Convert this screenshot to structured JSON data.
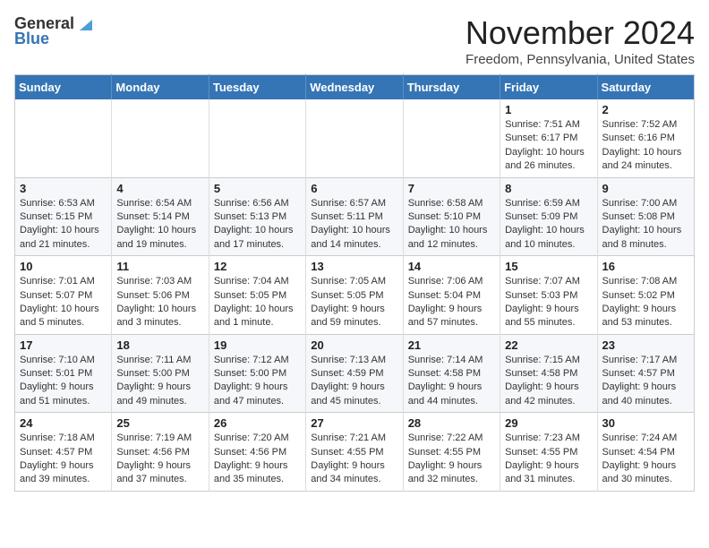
{
  "logo": {
    "line1": "General",
    "line2": "Blue"
  },
  "title": "November 2024",
  "location": "Freedom, Pennsylvania, United States",
  "weekdays": [
    "Sunday",
    "Monday",
    "Tuesday",
    "Wednesday",
    "Thursday",
    "Friday",
    "Saturday"
  ],
  "weeks": [
    [
      {
        "day": "",
        "info": ""
      },
      {
        "day": "",
        "info": ""
      },
      {
        "day": "",
        "info": ""
      },
      {
        "day": "",
        "info": ""
      },
      {
        "day": "",
        "info": ""
      },
      {
        "day": "1",
        "info": "Sunrise: 7:51 AM\nSunset: 6:17 PM\nDaylight: 10 hours\nand 26 minutes."
      },
      {
        "day": "2",
        "info": "Sunrise: 7:52 AM\nSunset: 6:16 PM\nDaylight: 10 hours\nand 24 minutes."
      }
    ],
    [
      {
        "day": "3",
        "info": "Sunrise: 6:53 AM\nSunset: 5:15 PM\nDaylight: 10 hours\nand 21 minutes."
      },
      {
        "day": "4",
        "info": "Sunrise: 6:54 AM\nSunset: 5:14 PM\nDaylight: 10 hours\nand 19 minutes."
      },
      {
        "day": "5",
        "info": "Sunrise: 6:56 AM\nSunset: 5:13 PM\nDaylight: 10 hours\nand 17 minutes."
      },
      {
        "day": "6",
        "info": "Sunrise: 6:57 AM\nSunset: 5:11 PM\nDaylight: 10 hours\nand 14 minutes."
      },
      {
        "day": "7",
        "info": "Sunrise: 6:58 AM\nSunset: 5:10 PM\nDaylight: 10 hours\nand 12 minutes."
      },
      {
        "day": "8",
        "info": "Sunrise: 6:59 AM\nSunset: 5:09 PM\nDaylight: 10 hours\nand 10 minutes."
      },
      {
        "day": "9",
        "info": "Sunrise: 7:00 AM\nSunset: 5:08 PM\nDaylight: 10 hours\nand 8 minutes."
      }
    ],
    [
      {
        "day": "10",
        "info": "Sunrise: 7:01 AM\nSunset: 5:07 PM\nDaylight: 10 hours\nand 5 minutes."
      },
      {
        "day": "11",
        "info": "Sunrise: 7:03 AM\nSunset: 5:06 PM\nDaylight: 10 hours\nand 3 minutes."
      },
      {
        "day": "12",
        "info": "Sunrise: 7:04 AM\nSunset: 5:05 PM\nDaylight: 10 hours\nand 1 minute."
      },
      {
        "day": "13",
        "info": "Sunrise: 7:05 AM\nSunset: 5:05 PM\nDaylight: 9 hours\nand 59 minutes."
      },
      {
        "day": "14",
        "info": "Sunrise: 7:06 AM\nSunset: 5:04 PM\nDaylight: 9 hours\nand 57 minutes."
      },
      {
        "day": "15",
        "info": "Sunrise: 7:07 AM\nSunset: 5:03 PM\nDaylight: 9 hours\nand 55 minutes."
      },
      {
        "day": "16",
        "info": "Sunrise: 7:08 AM\nSunset: 5:02 PM\nDaylight: 9 hours\nand 53 minutes."
      }
    ],
    [
      {
        "day": "17",
        "info": "Sunrise: 7:10 AM\nSunset: 5:01 PM\nDaylight: 9 hours\nand 51 minutes."
      },
      {
        "day": "18",
        "info": "Sunrise: 7:11 AM\nSunset: 5:00 PM\nDaylight: 9 hours\nand 49 minutes."
      },
      {
        "day": "19",
        "info": "Sunrise: 7:12 AM\nSunset: 5:00 PM\nDaylight: 9 hours\nand 47 minutes."
      },
      {
        "day": "20",
        "info": "Sunrise: 7:13 AM\nSunset: 4:59 PM\nDaylight: 9 hours\nand 45 minutes."
      },
      {
        "day": "21",
        "info": "Sunrise: 7:14 AM\nSunset: 4:58 PM\nDaylight: 9 hours\nand 44 minutes."
      },
      {
        "day": "22",
        "info": "Sunrise: 7:15 AM\nSunset: 4:58 PM\nDaylight: 9 hours\nand 42 minutes."
      },
      {
        "day": "23",
        "info": "Sunrise: 7:17 AM\nSunset: 4:57 PM\nDaylight: 9 hours\nand 40 minutes."
      }
    ],
    [
      {
        "day": "24",
        "info": "Sunrise: 7:18 AM\nSunset: 4:57 PM\nDaylight: 9 hours\nand 39 minutes."
      },
      {
        "day": "25",
        "info": "Sunrise: 7:19 AM\nSunset: 4:56 PM\nDaylight: 9 hours\nand 37 minutes."
      },
      {
        "day": "26",
        "info": "Sunrise: 7:20 AM\nSunset: 4:56 PM\nDaylight: 9 hours\nand 35 minutes."
      },
      {
        "day": "27",
        "info": "Sunrise: 7:21 AM\nSunset: 4:55 PM\nDaylight: 9 hours\nand 34 minutes."
      },
      {
        "day": "28",
        "info": "Sunrise: 7:22 AM\nSunset: 4:55 PM\nDaylight: 9 hours\nand 32 minutes."
      },
      {
        "day": "29",
        "info": "Sunrise: 7:23 AM\nSunset: 4:55 PM\nDaylight: 9 hours\nand 31 minutes."
      },
      {
        "day": "30",
        "info": "Sunrise: 7:24 AM\nSunset: 4:54 PM\nDaylight: 9 hours\nand 30 minutes."
      }
    ]
  ]
}
